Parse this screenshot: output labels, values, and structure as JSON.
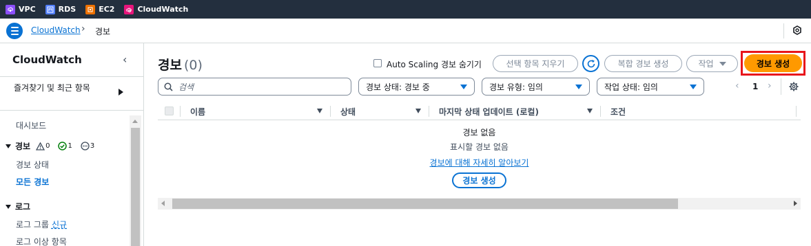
{
  "favorites": [
    {
      "label": "VPC",
      "icon": "vpc-icon",
      "color": "#8c4fff"
    },
    {
      "label": "RDS",
      "icon": "rds-icon",
      "color": "#527fff"
    },
    {
      "label": "EC2",
      "icon": "ec2-icon",
      "color": "#ed7100"
    },
    {
      "label": "CloudWatch",
      "icon": "cloudwatch-icon",
      "color": "#e7157b"
    }
  ],
  "breadcrumb": {
    "service": "CloudWatch",
    "current": "경보"
  },
  "sidebar": {
    "title": "CloudWatch",
    "favorites_label": "즐겨찾기 및 최근 항목",
    "dashboard": "대시보드",
    "alarms_section": "경보",
    "alarm_counts": {
      "alarm": "0",
      "ok": "1",
      "insufficient": "3"
    },
    "alarm_state": "경보 상태",
    "all_alarms": "모든 경보",
    "logs_section": "로그",
    "log_groups": "로그 그룹",
    "log_groups_new": "신규",
    "log_anomalies": "로그 이상 항목"
  },
  "header": {
    "title": "경보",
    "count": "(0)",
    "hide_autoscaling": "Auto Scaling 경보 숨기기",
    "clear_selection": "선택 항목 지우기",
    "create_composite": "복합 경보 생성",
    "actions": "작업",
    "create_alarm": "경보 생성",
    "accent_color": "#ff9900"
  },
  "filters": {
    "search_placeholder": "검색",
    "state": "경보 상태: 경보 중",
    "type": "경보 유형: 임의",
    "action_state": "작업 상태: 임의",
    "page": "1"
  },
  "table": {
    "columns": [
      "이름",
      "상태",
      "마지막 상태 업데이트 (로컬)",
      "조건"
    ],
    "empty_title": "경보 없음",
    "empty_subtitle": "표시할 경보 없음",
    "learn_more": "경보에 대해 자세히 알아보기",
    "create_button": "경보 생성"
  }
}
